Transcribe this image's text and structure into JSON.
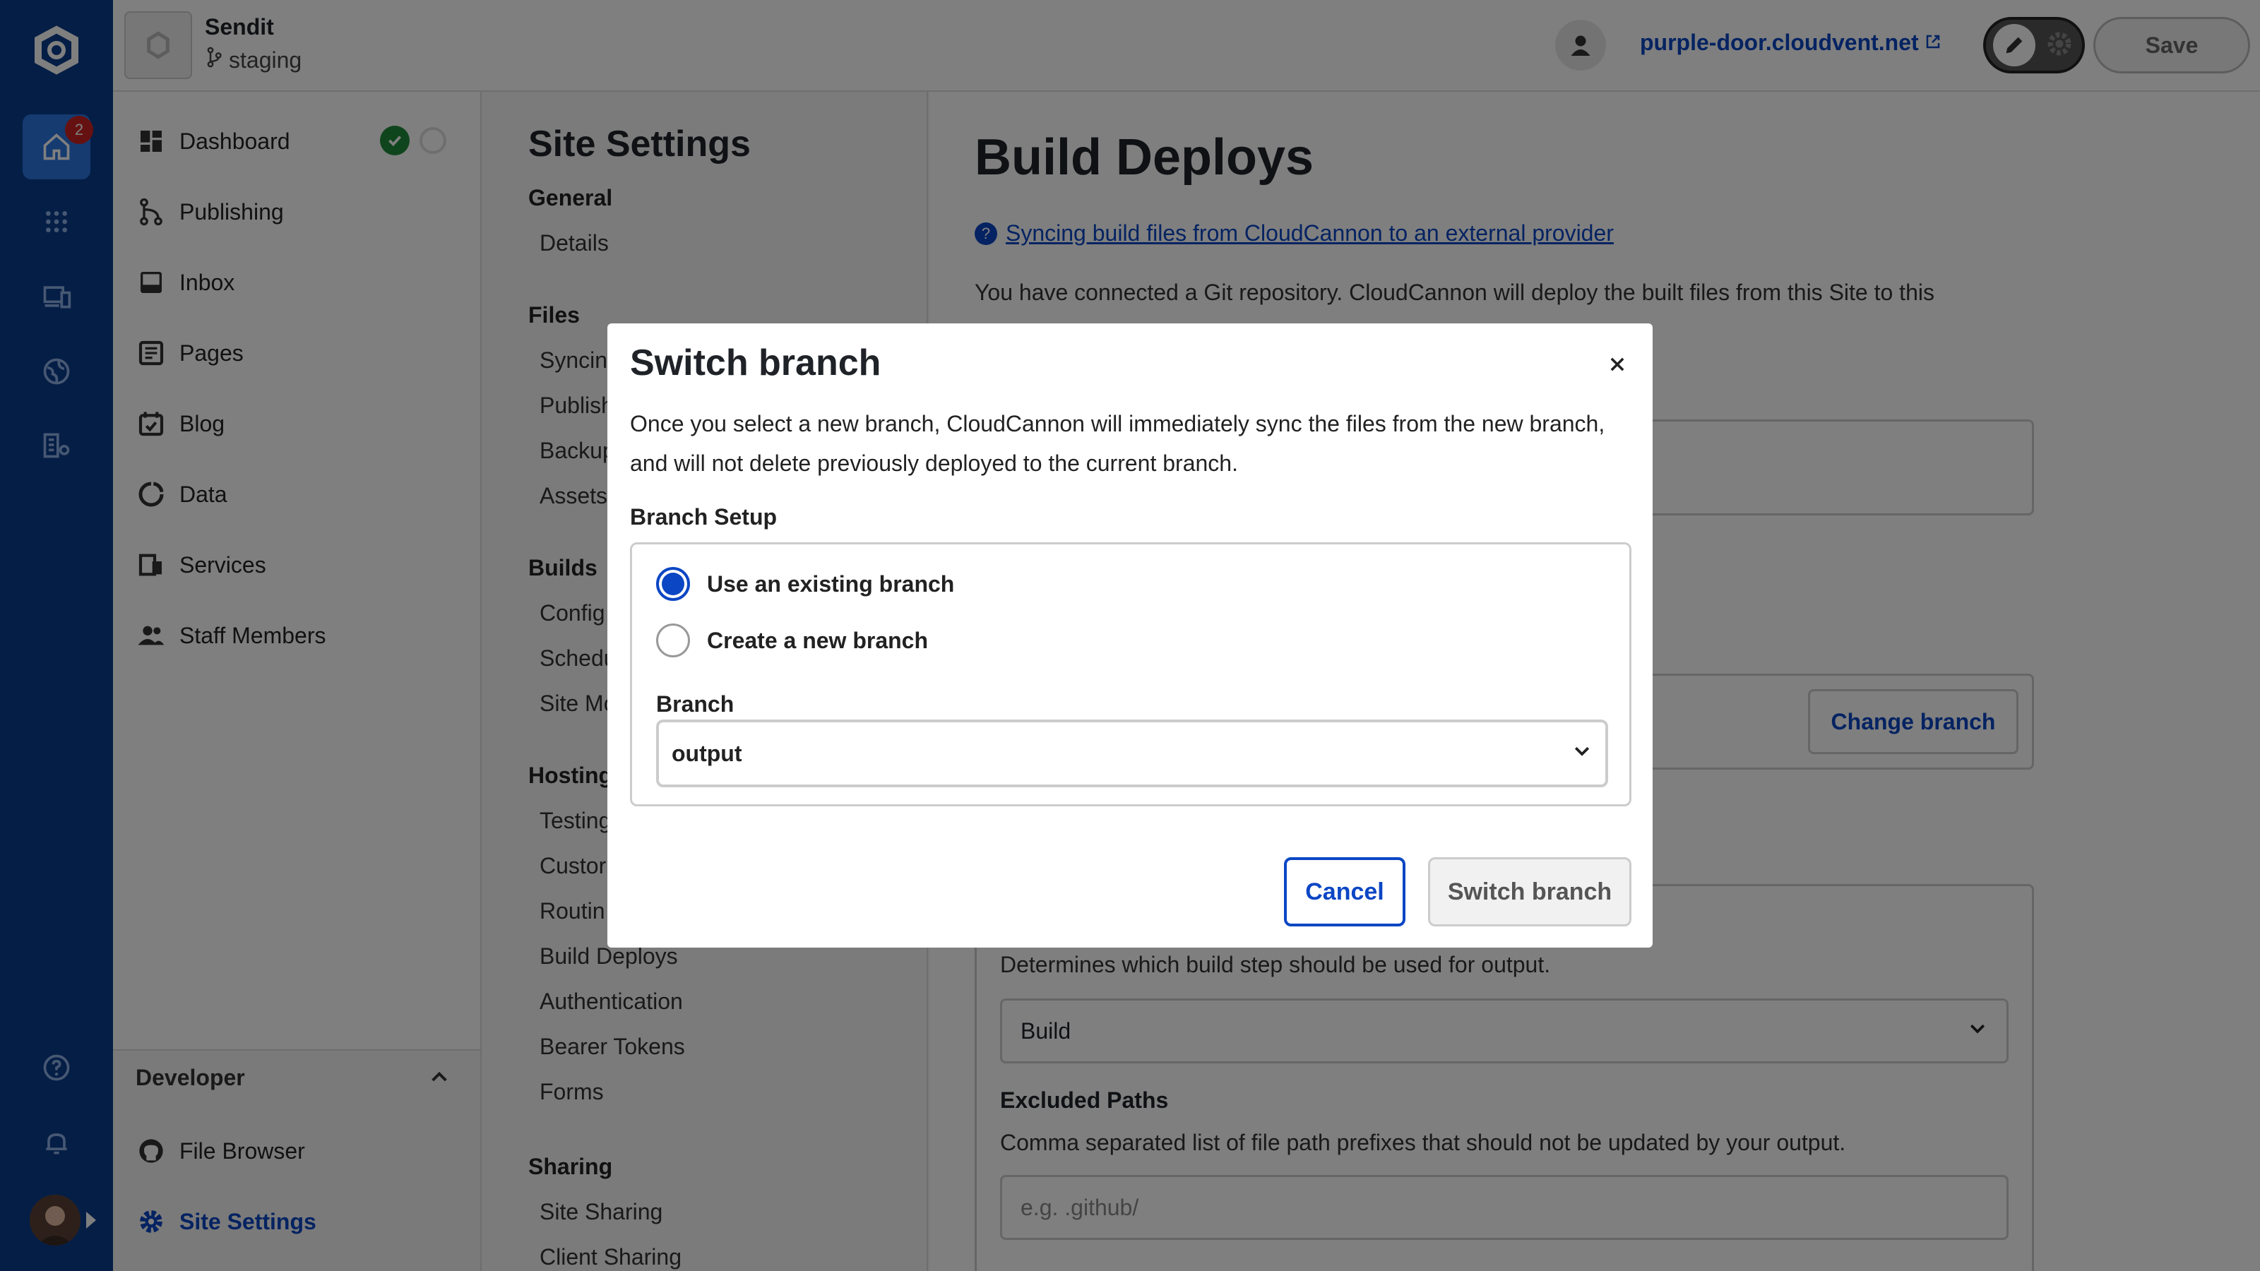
{
  "app": {
    "site_name": "Sendit",
    "branch_name": "staging",
    "domain": "purple-door.cloudvent.net",
    "save_label": "Save",
    "notification_count": "2"
  },
  "sidebar": {
    "items": [
      {
        "label": "Dashboard",
        "icon": "dashboard-icon"
      },
      {
        "label": "Publishing",
        "icon": "publishing-icon"
      },
      {
        "label": "Inbox",
        "icon": "inbox-icon"
      },
      {
        "label": "Pages",
        "icon": "pages-icon"
      },
      {
        "label": "Blog",
        "icon": "blog-icon"
      },
      {
        "label": "Data",
        "icon": "data-icon"
      },
      {
        "label": "Services",
        "icon": "services-icon"
      },
      {
        "label": "Staff Members",
        "icon": "staff-icon"
      }
    ],
    "developer": {
      "title": "Developer",
      "items": [
        {
          "label": "File Browser",
          "icon": "github-icon"
        },
        {
          "label": "Site Settings",
          "icon": "gear-icon"
        }
      ]
    }
  },
  "settings_nav": {
    "title": "Site Settings",
    "general": {
      "heading": "General",
      "items": [
        "Details"
      ]
    },
    "files": {
      "heading": "Files",
      "items": [
        "Syncin",
        "Publish",
        "Backup",
        "Assets"
      ]
    },
    "builds": {
      "heading": "Builds",
      "items": [
        "Config",
        "Schedu",
        "Site Mo"
      ]
    },
    "hosting": {
      "heading": "Hosting",
      "items": [
        "Testing",
        "Custor",
        "Routin",
        "Build Deploys",
        "Authentication",
        "Bearer Tokens",
        "Forms"
      ]
    },
    "sharing": {
      "heading": "Sharing",
      "items": [
        "Site Sharing",
        "Client Sharing"
      ]
    }
  },
  "main": {
    "title": "Build Deploys",
    "help_link": "Syncing build files from CloudCannon to an external provider",
    "description": "You have connected a Git repository. CloudCannon will deploy the built files from this Site to this",
    "change_branch_label": "Change branch",
    "output_description": "Determines which build step should be used for output.",
    "build_select_value": "Build",
    "excluded_paths_label": "Excluded Paths",
    "excluded_paths_description": "Comma separated list of file path prefixes that should not be updated by your output.",
    "excluded_paths_placeholder": "e.g. .github/"
  },
  "modal": {
    "title": "Switch branch",
    "description": "Once you select a new branch, CloudCannon will immediately sync the files from the new branch, and will not delete previously deployed to the current branch.",
    "branch_setup_label": "Branch Setup",
    "options": [
      "Use an existing branch",
      "Create a new branch"
    ],
    "selected_option": "Use an existing branch",
    "branch_label": "Branch",
    "branch_value": "output",
    "cancel_label": "Cancel",
    "switch_label": "Switch branch"
  },
  "colors": {
    "rail": "#0b3c8c",
    "accent": "#0b46c4",
    "success": "#1f8a3a",
    "badge": "#cc2222"
  }
}
